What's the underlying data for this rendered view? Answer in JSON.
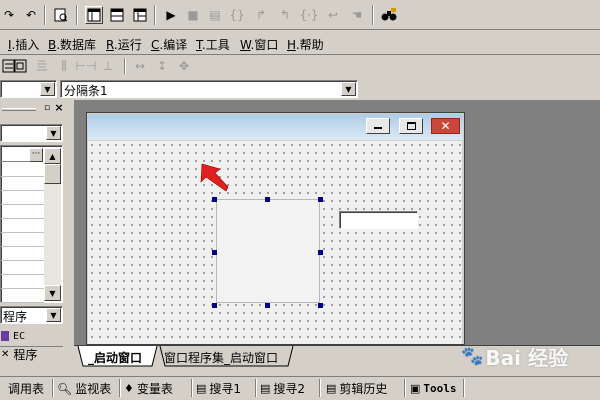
{
  "menu": {
    "items": [
      {
        "key": "I",
        "rest": ".插入"
      },
      {
        "key": "B",
        "rest": ".数据库"
      },
      {
        "key": "R",
        "rest": ".运行"
      },
      {
        "key": "C",
        "rest": ".编译"
      },
      {
        "key": "T",
        "rest": ".工具"
      },
      {
        "key": "W",
        "rest": ".窗口"
      },
      {
        "key": "H",
        "rest": ".帮助"
      }
    ]
  },
  "property_combo": {
    "value": "分隔条1"
  },
  "left_panel": {
    "type_combo": "程序",
    "tree_item": "EC",
    "tab_label": "程序"
  },
  "window_tabs": {
    "active": "_启动窗口",
    "inactive": "窗口程序集_启动窗口"
  },
  "bottom_tabs": [
    {
      "label": "调用表"
    },
    {
      "label": "监视表"
    },
    {
      "label": "变量表"
    },
    {
      "label": "搜寻1"
    },
    {
      "label": "搜寻2"
    },
    {
      "label": "剪辑历史"
    },
    {
      "label": "Tools"
    }
  ],
  "watermark": {
    "text": "Bai 经验"
  },
  "colors": {
    "accent": "#0a246a",
    "selection_handle": "#00008b",
    "arrow": "#e02020"
  }
}
